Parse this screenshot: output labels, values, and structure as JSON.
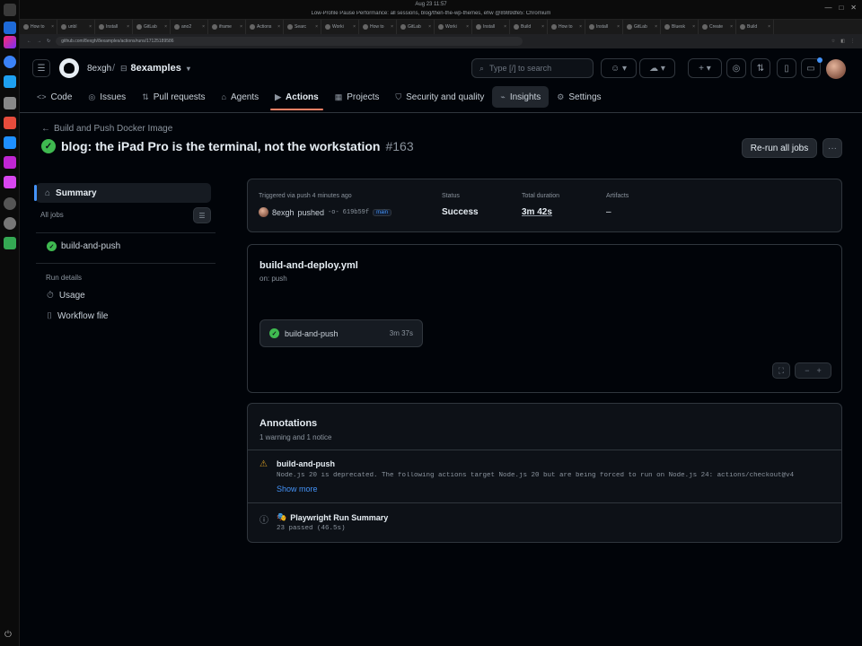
{
  "os": {
    "clock": "Aug 23 11:57",
    "window_title": "Low-Profile Pause Performance: all sessions, blog/then-the-wp-themes, ehw @8989dfe5: Chromium"
  },
  "colors": {
    "accent_blue": "#4493f8",
    "success_green": "#3fb950",
    "active_tab_underline": "#f78166",
    "warning_yellow": "#d29922",
    "background": "#010409"
  },
  "browser": {
    "tabs": [
      "How to",
      "unbl",
      "Install",
      "GitLab",
      "ano2",
      "iframe",
      "Actions",
      "Searc",
      "Worki",
      "How to",
      "GitLab",
      "Worki",
      "Install",
      "Build",
      "How to",
      "Install",
      "GitLab",
      "Bluesk",
      "Create",
      "Build"
    ],
    "url": "github.com/8exgh/8examples/actions/runs/17125189586"
  },
  "header": {
    "owner": "8exgh",
    "repo": "8examples",
    "search_placeholder": "Type [/] to search"
  },
  "repo_nav": [
    {
      "label": "Code",
      "icon": "code-icon"
    },
    {
      "label": "Issues",
      "icon": "issue-icon"
    },
    {
      "label": "Pull requests",
      "icon": "pull-request-icon"
    },
    {
      "label": "Agents",
      "icon": "agent-icon"
    },
    {
      "label": "Actions",
      "icon": "play-icon"
    },
    {
      "label": "Projects",
      "icon": "table-icon"
    },
    {
      "label": "Security and quality",
      "icon": "shield-icon"
    },
    {
      "label": "Insights",
      "icon": "graph-icon"
    },
    {
      "label": "Settings",
      "icon": "gear-icon"
    }
  ],
  "run": {
    "back_link": "Build and Push Docker Image",
    "title": "blog: the iPad Pro is the terminal, not the workstation",
    "number": "#163",
    "rerun_label": "Re-run all jobs"
  },
  "sidebar": {
    "summary": "Summary",
    "all_jobs": "All jobs",
    "job": "build-and-push",
    "run_details": "Run details",
    "usage": "Usage",
    "workflow_file": "Workflow file"
  },
  "stats": {
    "trigger_label": "Triggered via push 4 minutes ago",
    "actor": "8exgh",
    "pushed": "pushed",
    "sha": "619b59f",
    "branch": "main",
    "status_label": "Status",
    "status_value": "Success",
    "duration_label": "Total duration",
    "duration_value": "3m 42s",
    "artifacts_label": "Artifacts",
    "artifacts_value": "–"
  },
  "workflow": {
    "file": "build-and-deploy.yml",
    "trigger": "on: push",
    "job_name": "build-and-push",
    "job_duration": "3m 37s"
  },
  "annotations": {
    "title": "Annotations",
    "subtitle": "1 warning and 1 notice",
    "warning_job": "build-and-push",
    "warning_message": "Node.js 20 is deprecated. The following actions target Node.js 20 but are being forced to run on Node.js 24: actions/checkout@v4",
    "show_more": "Show more",
    "notice_job": "Playwright Run Summary",
    "notice_message": "23 passed (46.5s)"
  }
}
